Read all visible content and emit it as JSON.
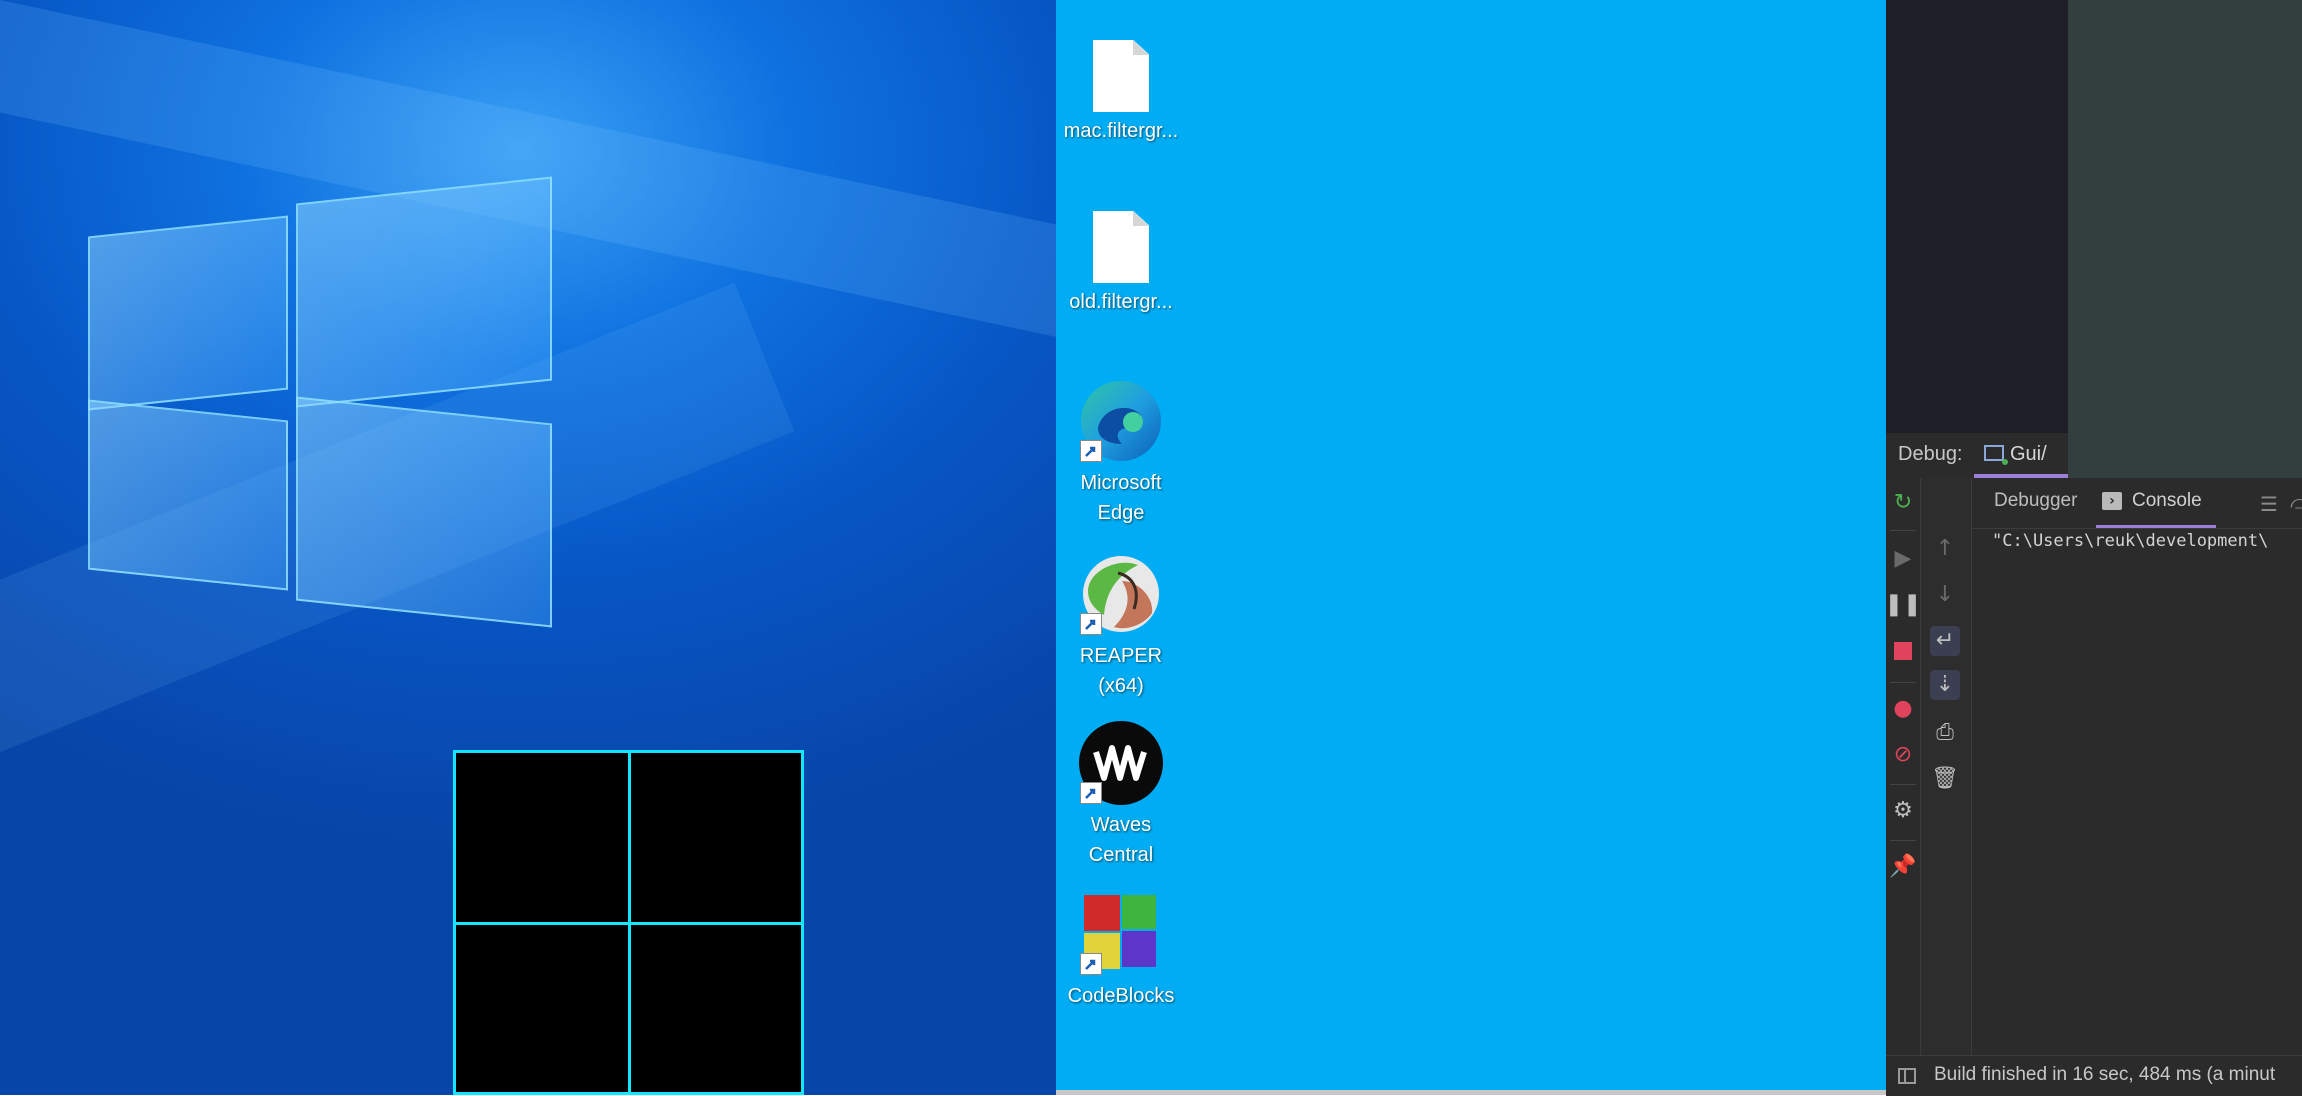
{
  "desktop": {
    "items": [
      {
        "label": "mac.filtergr...",
        "icon": "file-icon"
      },
      {
        "label": "old.filtergr...",
        "icon": "file-icon"
      },
      {
        "label": "Microsoft Edge",
        "icon": "edge-icon"
      },
      {
        "label": "REAPER (x64)",
        "icon": "reaper-icon"
      },
      {
        "label": "Waves Central",
        "icon": "waves-icon"
      },
      {
        "label": "CodeBlocks",
        "icon": "codeblocks-icon"
      }
    ]
  },
  "ide": {
    "debug_label": "Debug:",
    "gui_tab_label": "Gui/",
    "tabs": {
      "debugger": "Debugger",
      "console": "Console"
    },
    "console_line": "\"C:\\Users\\reuk\\development\\",
    "status_text": "Build finished in 16 sec, 484 ms (a minut"
  },
  "colors": {
    "desktop_bg": "#00adf4",
    "accent_tab": "#9b7fd8",
    "window_tile_border": "#14e6ff"
  }
}
